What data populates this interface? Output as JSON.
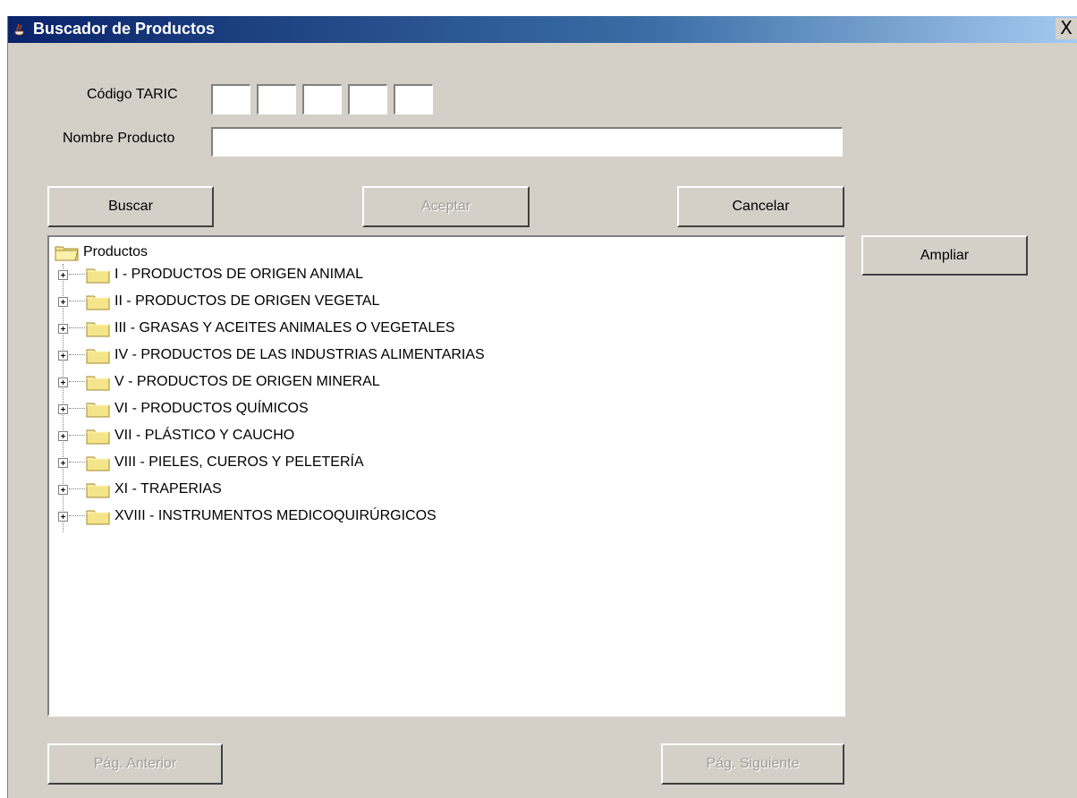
{
  "window": {
    "title": "Buscador de Productos",
    "close_label": "X"
  },
  "form": {
    "taric_label": "Código TARIC",
    "taric_values": [
      "",
      "",
      "",
      "",
      ""
    ],
    "product_name_label": "Nombre Producto",
    "product_name_value": ""
  },
  "buttons": {
    "search": "Buscar",
    "accept": "Aceptar",
    "cancel": "Cancelar",
    "expand": "Ampliar",
    "prev_page": "Pág. Anterior",
    "next_page": "Pág. Siguiente"
  },
  "tree": {
    "root": "Productos",
    "items": [
      "I - PRODUCTOS DE ORIGEN ANIMAL",
      "II - PRODUCTOS DE ORIGEN VEGETAL",
      "III - GRASAS Y ACEITES ANIMALES O VEGETALES",
      "IV - PRODUCTOS DE LAS INDUSTRIAS ALIMENTARIAS",
      "V - PRODUCTOS DE ORIGEN MINERAL",
      "VI - PRODUCTOS QUÍMICOS",
      "VII - PLÁSTICO Y CAUCHO",
      "VIII - PIELES, CUEROS Y PELETERÍA",
      "XI - TRAPERIAS",
      "XVIII - INSTRUMENTOS MEDICOQUIRÚRGICOS"
    ]
  },
  "colors": {
    "titlebar": "#0a246a",
    "window_bg": "#d4d0c8",
    "folder": "#f5e58a"
  }
}
